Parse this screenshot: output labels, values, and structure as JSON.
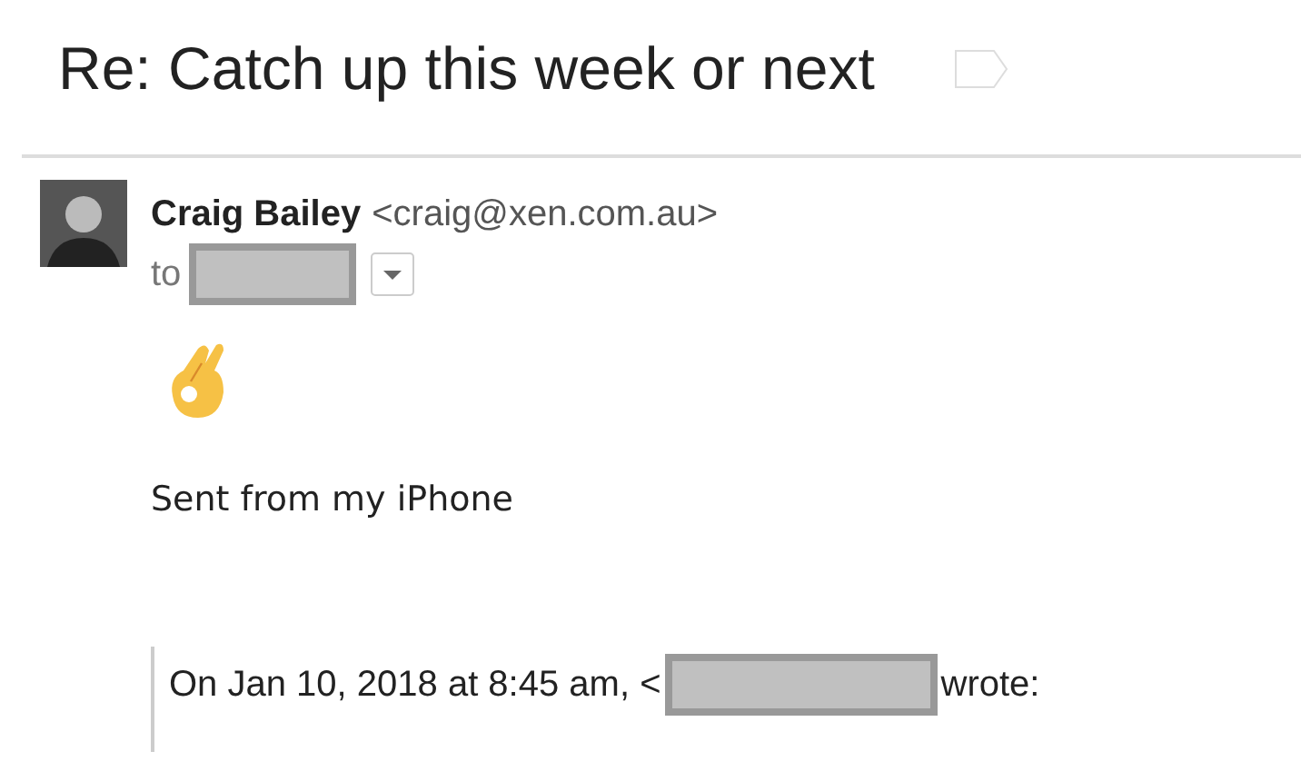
{
  "subject": "Re: Catch up this week or next",
  "sender": {
    "name": "Craig Bailey",
    "email": "<craig@xen.com.au>"
  },
  "recipient": {
    "prefix": "to"
  },
  "body": {
    "signature": "Sent from my iPhone"
  },
  "quote": {
    "prefix": "On Jan 10, 2018 at 8:45 am, <",
    "suffix": "wrote:"
  }
}
